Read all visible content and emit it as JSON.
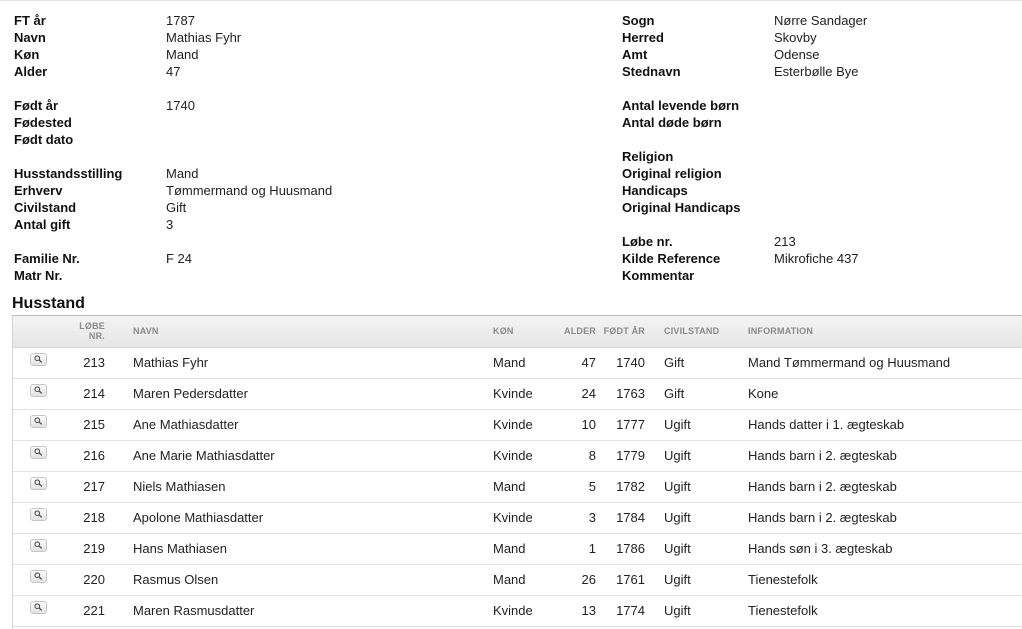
{
  "record": {
    "left": [
      {
        "label": "FT år",
        "value": "1787"
      },
      {
        "label": "Navn",
        "value": "Mathias Fyhr"
      },
      {
        "label": "Køn",
        "value": "Mand"
      },
      {
        "label": "Alder",
        "value": "47"
      },
      null,
      {
        "label": "Født år",
        "value": "1740"
      },
      {
        "label": "Fødested",
        "value": ""
      },
      {
        "label": "Født dato",
        "value": ""
      },
      null,
      {
        "label": "Husstandsstilling",
        "value": "Mand"
      },
      {
        "label": "Erhverv",
        "value": "Tømmermand og Huusmand"
      },
      {
        "label": "Civilstand",
        "value": "Gift"
      },
      {
        "label": "Antal gift",
        "value": "3"
      },
      null,
      {
        "label": "Familie Nr.",
        "value": "F 24"
      },
      {
        "label": "Matr Nr.",
        "value": ""
      }
    ],
    "right": [
      {
        "label": "Sogn",
        "value": "Nørre Sandager"
      },
      {
        "label": "Herred",
        "value": "Skovby"
      },
      {
        "label": "Amt",
        "value": "Odense"
      },
      {
        "label": "Stednavn",
        "value": "Esterbølle Bye"
      },
      null,
      {
        "label": "Antal levende børn",
        "value": ""
      },
      {
        "label": "Antal døde børn",
        "value": ""
      },
      null,
      {
        "label": "Religion",
        "value": ""
      },
      {
        "label": "Original religion",
        "value": ""
      },
      {
        "label": "Handicaps",
        "value": ""
      },
      {
        "label": "Original Handicaps",
        "value": ""
      },
      null,
      {
        "label": "Løbe nr.",
        "value": "213"
      },
      {
        "label": "Kilde Reference",
        "value": "Mikrofiche 437"
      },
      {
        "label": "Kommentar",
        "value": ""
      }
    ]
  },
  "household": {
    "title": "Husstand",
    "columns": [
      "",
      "Løbe nr.",
      "Navn",
      "Køn",
      "Alder",
      "Født år",
      "Civilstand",
      "Information"
    ],
    "icon": "magnifier-icon",
    "rows": [
      [
        "213",
        "Mathias Fyhr",
        "Mand",
        "47",
        "1740",
        "Gift",
        "Mand Tømmermand og Huusmand"
      ],
      [
        "214",
        "Maren Pedersdatter",
        "Kvinde",
        "24",
        "1763",
        "Gift",
        "Kone"
      ],
      [
        "215",
        "Ane Mathiasdatter",
        "Kvinde",
        "10",
        "1777",
        "Ugift",
        "Hands datter i 1. ægteskab"
      ],
      [
        "216",
        "Ane Marie Mathiasdatter",
        "Kvinde",
        "8",
        "1779",
        "Ugift",
        "Hands barn i 2. ægteskab"
      ],
      [
        "217",
        "Niels Mathiasen",
        "Mand",
        "5",
        "1782",
        "Ugift",
        "Hands barn i 2. ægteskab"
      ],
      [
        "218",
        "Apolone Mathiasdatter",
        "Kvinde",
        "3",
        "1784",
        "Ugift",
        "Hands barn i 2. ægteskab"
      ],
      [
        "219",
        "Hans Mathiasen",
        "Mand",
        "1",
        "1786",
        "Ugift",
        "Hands søn i 3. ægteskab"
      ],
      [
        "220",
        "Rasmus Olsen",
        "Mand",
        "26",
        "1761",
        "Ugift",
        "Tienestefolk"
      ],
      [
        "221",
        "Maren Rasmusdatter",
        "Kvinde",
        "13",
        "1774",
        "Ugift",
        "Tienestefolk"
      ]
    ]
  }
}
